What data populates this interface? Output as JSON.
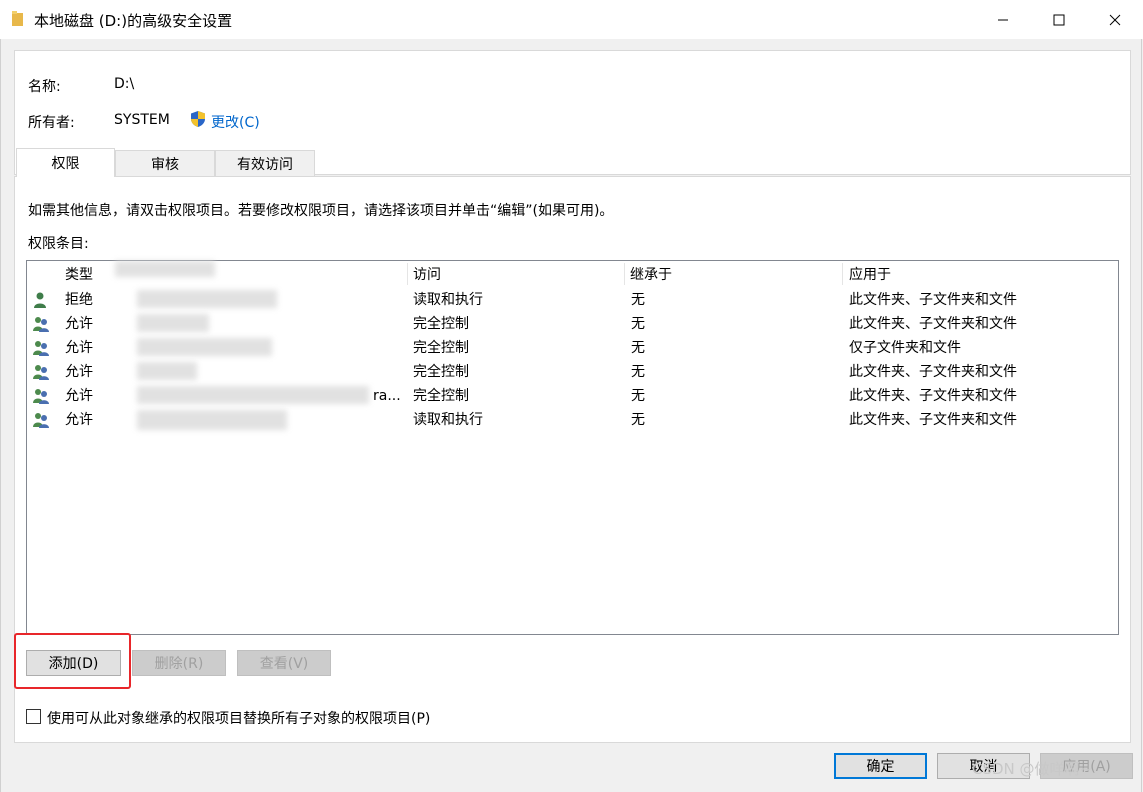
{
  "window": {
    "title": "本地磁盘 (D:)的高级安全设置",
    "minimize_icon": "minimize-icon",
    "maximize_icon": "maximize-icon",
    "close_icon": "close-icon"
  },
  "info": {
    "name_label": "名称:",
    "name_value": "D:\\",
    "owner_label": "所有者:",
    "owner_value": "SYSTEM",
    "change_link": "更改(C)"
  },
  "tabs": [
    {
      "label": "权限",
      "active": true
    },
    {
      "label": "审核",
      "active": false
    },
    {
      "label": "有效访问",
      "active": false
    }
  ],
  "description": "如需其他信息，请双击权限项目。若要修改权限项目，请选择该项目并单击“编辑”(如果可用)。",
  "entries_label": "权限条目:",
  "columns": [
    "类型",
    "主体",
    "访问",
    "继承于",
    "应用于"
  ],
  "rows": [
    {
      "icon": "user-icon",
      "type": "拒绝",
      "principal": "",
      "access": "读取和执行",
      "inherited": "无",
      "applies": "此文件夹、子文件夹和文件"
    },
    {
      "icon": "group-icon",
      "type": "允许",
      "principal": "",
      "access": "完全控制",
      "inherited": "无",
      "applies": "此文件夹、子文件夹和文件"
    },
    {
      "icon": "group-icon",
      "type": "允许",
      "principal": "",
      "access": "完全控制",
      "inherited": "无",
      "applies": "仅子文件夹和文件"
    },
    {
      "icon": "group-icon",
      "type": "允许",
      "principal": "",
      "access": "完全控制",
      "inherited": "无",
      "applies": "此文件夹、子文件夹和文件"
    },
    {
      "icon": "group-icon",
      "type": "允许",
      "principal": "ra...",
      "access": "完全控制",
      "inherited": "无",
      "applies": "此文件夹、子文件夹和文件"
    },
    {
      "icon": "group-icon",
      "type": "允许",
      "principal": "",
      "access": "读取和执行",
      "inherited": "无",
      "applies": "此文件夹、子文件夹和文件"
    }
  ],
  "buttons": {
    "add": "添加(D)",
    "remove": "删除(R)",
    "view": "查看(V)",
    "ok": "确定",
    "cancel": "取消",
    "apply": "应用(A)"
  },
  "checkbox_label": "使用可从此对象继承的权限项目替换所有子对象的权限项目(P)",
  "watermark": "CSDN @做咩啊~",
  "colors": {
    "link": "#0066cc",
    "highlight": "#e8262a",
    "default_button_border": "#0078d7"
  }
}
